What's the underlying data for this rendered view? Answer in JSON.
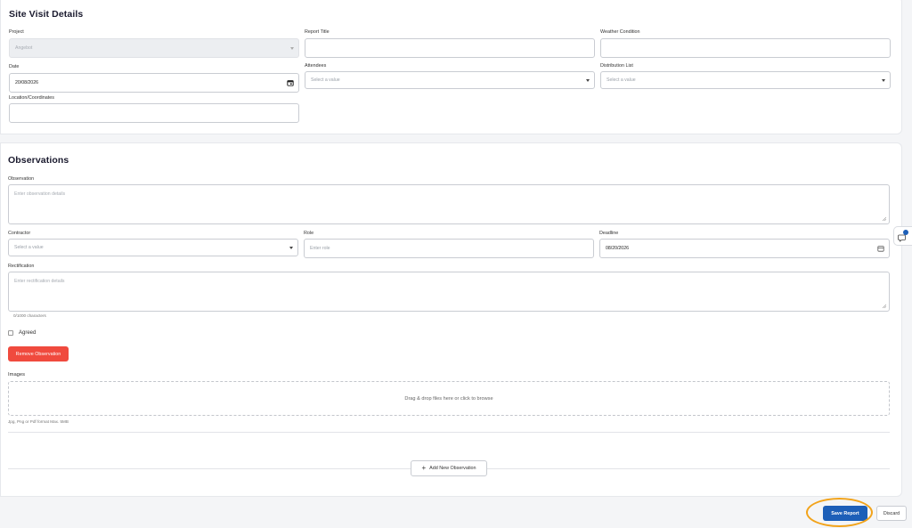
{
  "site_visit": {
    "title": "Site Visit Details",
    "project": {
      "label": "Project",
      "value": "Angebot"
    },
    "report_title": {
      "label": "Report Title",
      "value": ""
    },
    "weather": {
      "label": "Weather Condition",
      "value": ""
    },
    "date": {
      "label": "Date",
      "value": "20/08/2026"
    },
    "attendees": {
      "label": "Attendees",
      "placeholder": "Select a value"
    },
    "distribution_list": {
      "label": "Distribution List",
      "placeholder": "Select a value"
    },
    "location": {
      "label": "Location/Coordinates",
      "value": ""
    }
  },
  "observations": {
    "title": "Observations",
    "observation": {
      "label": "Observation",
      "placeholder": "Enter observation details"
    },
    "contractor": {
      "label": "Contractor",
      "placeholder": "Select a value"
    },
    "role": {
      "label": "Role",
      "placeholder": "Enter role"
    },
    "deadline": {
      "label": "Deadline",
      "value": "08/20/2026"
    },
    "rectification": {
      "label": "Rectification",
      "placeholder": "Enter rectification details",
      "counter": "0/1000 characters"
    },
    "agreed_label": "Agreed",
    "remove_button": "Remove Observation",
    "images": {
      "label": "Images",
      "dropzone_text": "Drag & drop files here or click to browse",
      "hint": "Jpg, Png or Pdf format Max. 5MB"
    },
    "add_button": "Add New Observation"
  },
  "footer": {
    "save_label": "Save Report",
    "discard_label": "Discard"
  },
  "colors": {
    "primary": "#1d5fb8",
    "danger": "#f04a3e",
    "highlight": "#f2a31a"
  }
}
